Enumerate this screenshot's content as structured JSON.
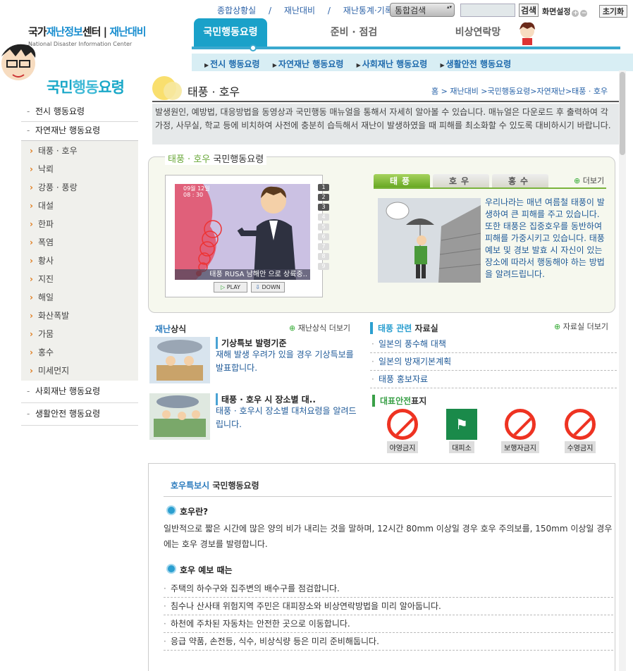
{
  "header": {
    "logo_main_a": "국가",
    "logo_main_b": "재난정보",
    "logo_main_c": "센터",
    "logo_sep": "|",
    "logo_sub": "재난대비",
    "logo_en": "National Disaster Information Center",
    "toplinks": [
      "종합상황실",
      "/",
      "재난대비",
      "/",
      "재난통계·기록"
    ],
    "search_select": "통합검색",
    "search_button": "검색",
    "screen_setting": "화면설정",
    "reset_button": "초기화",
    "nav_tabs": [
      "국민행동요령",
      "준비 · 점검",
      "비상연락망"
    ],
    "sub_nav": [
      "전시 행동요령",
      "자연재난 행동요령",
      "사회재난 행동요령",
      "생활안전 행동요령"
    ]
  },
  "sidebar": {
    "title_a": "국민",
    "title_b": "행동",
    "title_c": "요령",
    "items": [
      {
        "label": "전시 행동요령"
      },
      {
        "label": "자연재난 행동요령"
      },
      {
        "label": "사회재난 행동요령"
      },
      {
        "label": "생활안전 행동요령"
      }
    ],
    "sub_items": [
      "태풍 · 호우",
      "낙뢰",
      "강풍 · 풍랑",
      "대설",
      "한파",
      "폭염",
      "황사",
      "지진",
      "해일",
      "화산폭발",
      "가뭄",
      "홍수",
      "미세먼지"
    ]
  },
  "page": {
    "title": "태풍 · 호우",
    "breadcrumb": "홈 > 재난대비 >국민행동요령>자연재난>태풍 · 호우",
    "intro": "발생원인, 예방법, 대응방법을 동영상과 국민행동 매뉴얼을 통해서 자세히 알아볼 수 있습니다. 매뉴얼은 다운로드 후 출력하여 각 가정, 사무실, 학교 등에 비치하여 사전에 충분히 습득해서 재난이 발생하였을 때 피해를 최소화할 수 있도록 대비하시기 바랍니다."
  },
  "guide": {
    "header_a": "태풍 · 호우",
    "header_b": "국민행동요령",
    "video_time": "09월 12일\n08 : 30",
    "video_caption": "태풍 RUSA 남해안 으로 상륙중..",
    "video_numbers": [
      "1",
      "2",
      "3",
      "4",
      "5",
      "6",
      "7",
      "8",
      "9"
    ],
    "play": "PLAY",
    "down": "DOWN",
    "tabs": [
      "태풍",
      "호우",
      "홍수"
    ],
    "more": "더보기",
    "tab_text": "우리나라는 매년 여름철 태풍이 발생하여 큰 피해를 주고 있습니다. 또한 태풍은 집중호우를 동반하여 피해를 가중시키고 있습니다. 태풍 예보 및 경보 발효 시 자신이 있는 장소에 따라서 행동해야 하는 방법을 알려드립니다."
  },
  "knowledge": {
    "header_a": "재난",
    "header_b": "상식",
    "more": "재난상식 더보기",
    "cards": [
      {
        "title": "기상특보 발령기준",
        "desc": "재해 발생 우려가 있을 경우 기상특보를 발표합니다."
      },
      {
        "title": "태풍 · 호우 시 장소별 대..",
        "desc": "태풍 · 호우시 장소별 대처요령을 알려드립니다."
      }
    ]
  },
  "data_room": {
    "header_a": "태풍 관련",
    "header_b": "자료실",
    "more": "자료실 더보기",
    "items": [
      "일본의 풍수해 대책",
      "일본의 방재기본계획",
      "태풍 홍보자료"
    ]
  },
  "signs": {
    "header_a": "대표안전",
    "header_b": "표지",
    "items": [
      {
        "label": "야영금지",
        "icon": "no-camping-icon"
      },
      {
        "label": "대피소",
        "icon": "shelter-icon"
      },
      {
        "label": "보행자금지",
        "icon": "no-pedestrian-icon"
      },
      {
        "label": "수영금지",
        "icon": "no-swimming-icon"
      }
    ]
  },
  "rain": {
    "header_a": "호우특보시",
    "header_b": "국민행동요령",
    "q1": "호우란?",
    "p1": "일반적으로 짧은 시간에 많은 양의 비가 내리는 것을 말하며, 12시간 80mm 이상일 경우 호우 주의보를, 150mm 이상일 경우에는 호우 경보를 발령합니다.",
    "q2": "호우 예보 때는",
    "tips": [
      "주택의 하수구와 집주변의 배수구를 점검합니다.",
      "침수나 산사태 위험지역 주민은 대피장소와 비상연락방법을 미리 알아둡니다.",
      "하천에 주차된 자동차는 안전한 곳으로 이동합니다.",
      "응급 약품, 손전등, 식수, 비상식량 등은 미리 준비해둡니다."
    ]
  },
  "colors": {
    "accent": "#1aa1c9",
    "green": "#6aa83a",
    "link": "#1f5a98"
  }
}
